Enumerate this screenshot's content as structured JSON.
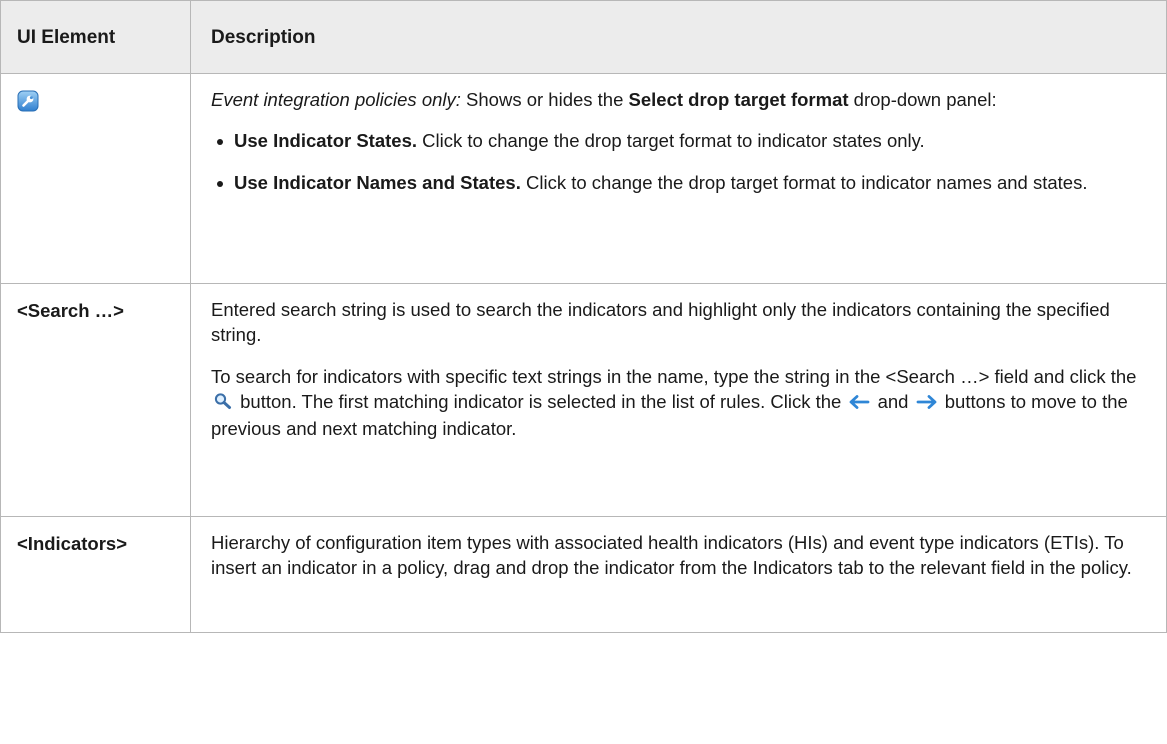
{
  "header": {
    "col1": "UI Element",
    "col2": "Description"
  },
  "rows": [
    {
      "element_icon": "wrench-icon",
      "intro_italic": "Event integration policies only:",
      "intro_text1": " Shows or hides the ",
      "intro_bold": "Select drop target format",
      "intro_text2": " drop-down panel:",
      "bullets": [
        {
          "bold": "Use Indicator States.",
          "text": " Click to change the drop target format to indicator states only."
        },
        {
          "bold": "Use Indicator Names and States.",
          "text": " Click to change the drop target format to indicator names and states."
        }
      ]
    },
    {
      "element": "<Search …>",
      "p1": "Entered search string is used to search the indicators and highlight only the indicators containing the specified string.",
      "p2_a": "To search for indicators with specific text strings in the name, type the string in the <Search …> field and click the ",
      "p2_b": " button. The first matching indicator is selected in the list of rules. Click the ",
      "p2_c": " and ",
      "p2_d": " buttons to move to the previous and next matching indicator.",
      "icons": [
        "search-icon",
        "arrow-left-icon",
        "arrow-right-icon"
      ]
    },
    {
      "element": "<Indicators>",
      "p1": "Hierarchy of configuration item types with associated health indicators (HIs) and event type indicators (ETIs). To insert an indicator in a policy, drag and drop the indicator from the Indicators tab to the relevant field in the policy."
    }
  ],
  "colors": {
    "header_bg": "#ececec",
    "border": "#b7b7b7",
    "text": "#1a1a1a",
    "icon_blue": "#3a8fd9"
  }
}
